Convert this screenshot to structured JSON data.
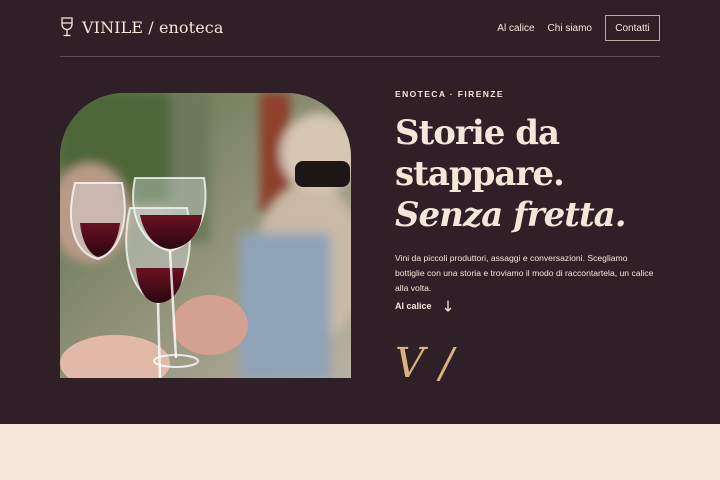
{
  "brand": {
    "name": "VINILE / enoteca",
    "icon": "wine-glass-icon"
  },
  "nav": {
    "links": [
      "Al calice",
      "Chi siamo"
    ],
    "cta": "Contatti"
  },
  "hero": {
    "image": {
      "subject": "wine-toast-photo"
    },
    "eyebrow": "ENOTECA · FIRENZE",
    "title": {
      "line1": "Storie da",
      "line2": "stappare.",
      "line3": "Senza fretta."
    },
    "lede": "Vini da piccoli produttori, assaggi e conversazioni. Scegliamo bottiglie con una storia e troviamo il modo di raccontartela, un calice alla volta.",
    "cta": {
      "label": "Al calice",
      "icon": "arrow-down-icon"
    },
    "monogram": "V /"
  },
  "colors": {
    "background": "#2f1f27",
    "text": "#f3e7da",
    "accent": "#d9b37d",
    "cream": "#f2e6d8"
  }
}
